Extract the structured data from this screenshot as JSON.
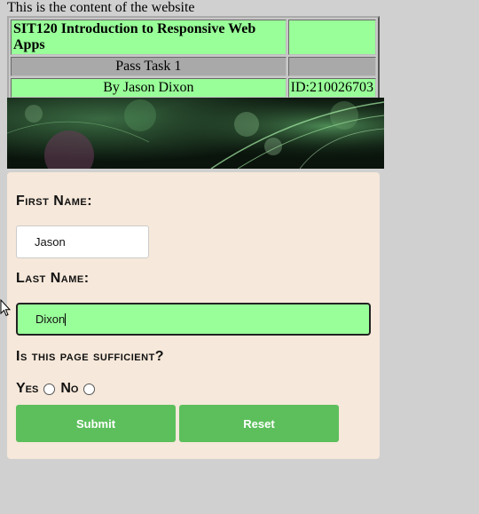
{
  "intro_text": "This is the content of the website",
  "header": {
    "title": "SIT120 Introduction to Responsive Web Apps",
    "task": "Pass Task 1",
    "author": "By Jason Dixon",
    "student_id": "ID:210026703"
  },
  "form": {
    "first_name_label": "First Name:",
    "first_name_value": "Jason",
    "last_name_label": "Last Name:",
    "last_name_value": "Dixon",
    "question": "Is this page sufficient?",
    "yes_label": "Yes",
    "no_label": "No",
    "submit_label": "Submit",
    "reset_label": "Reset"
  },
  "colors": {
    "accent_green": "#99ff99",
    "button_green": "#5cbf5c",
    "panel_bg": "#f6e8da"
  }
}
